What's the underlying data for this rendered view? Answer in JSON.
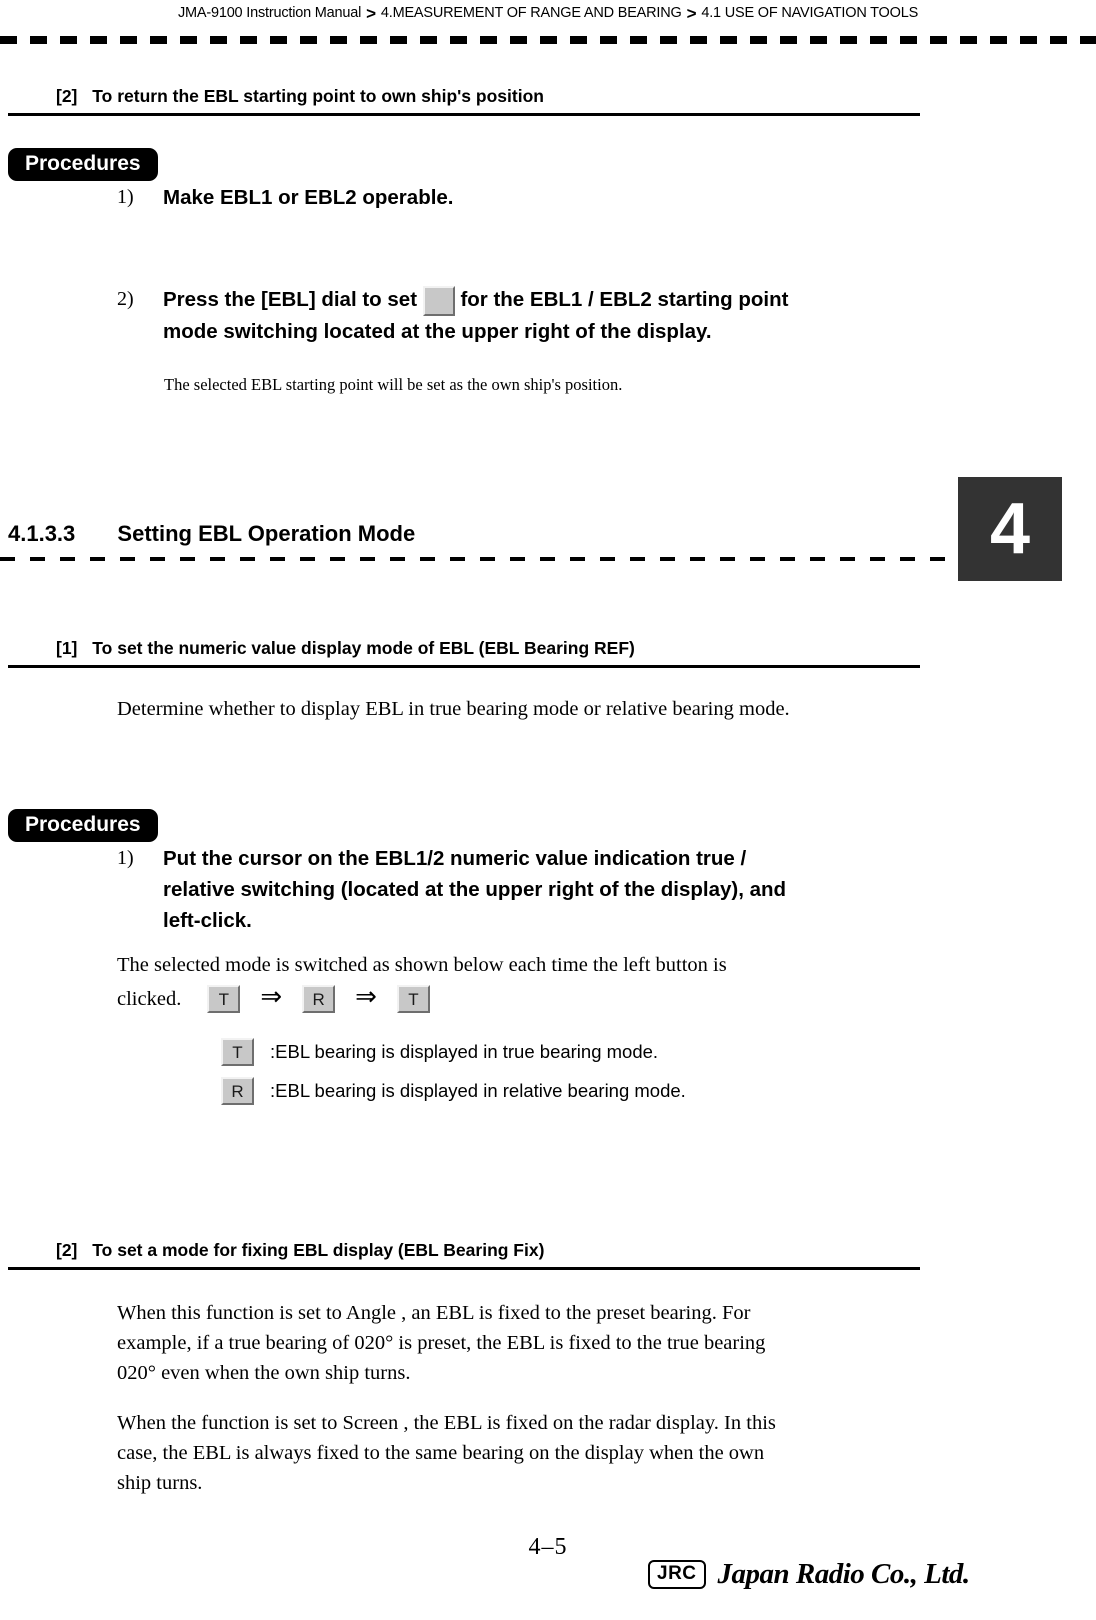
{
  "header": {
    "manual": "JMA-9100 Instruction Manual",
    "separator": ">",
    "chapter": "4.MEASUREMENT OF RANGE AND BEARING",
    "section": "4.1  USE OF NAVIGATION TOOLS"
  },
  "chapter_tab": {
    "number": "4"
  },
  "block1": {
    "heading_num": "[2]",
    "heading_text": "To return the EBL starting point to own ship's position",
    "procedures_label": "Procedures",
    "steps": [
      {
        "num": "1)",
        "text": "Make EBL1 or EBL2 operable."
      },
      {
        "num": "2)",
        "text_before": " Press the [EBL] dial to set",
        "button": "",
        "text_after": "for the EBL1 / EBL2 starting point",
        "line2": "mode switching located at the upper right of the display."
      }
    ],
    "note": "The selected EBL starting point will be set as the own ship's position."
  },
  "section_heading": {
    "number": "4.1.3.3",
    "title": "Setting EBL Operation Mode"
  },
  "block2": {
    "heading_num": "[1]",
    "heading_text": "To set the numeric value display mode of EBL (EBL Bearing REF)",
    "intro": "Determine whether to display EBL in true bearing mode or relative bearing mode.",
    "procedures_label": "Procedures",
    "step": {
      "num": "1)",
      "line1": "Put the cursor on the EBL1/2 numeric value indication true /",
      "line2": "relative switching (located at the upper right of the display), and",
      "line3": "left-click."
    },
    "explanation_line1": "The selected mode is switched as shown below each time the left button is",
    "explanation_line2": "clicked.",
    "switch_sequence": {
      "btn1": "T",
      "arrow1": "⇒",
      "btn2": "R",
      "arrow2": "⇒",
      "btn3": "T"
    },
    "legend": [
      {
        "button": "T",
        "text": ":EBL bearing is displayed in true bearing mode."
      },
      {
        "button": "R",
        "text": ":EBL bearing is displayed in relative bearing mode."
      }
    ]
  },
  "block3": {
    "heading_num": "[2]",
    "heading_text": "To set a mode for fixing EBL display (EBL Bearing Fix)",
    "para1_line1": "When this function is set to  Angle , an EBL is fixed to the preset bearing. For",
    "para1_line2": "example, if a true bearing of 020° is preset, the EBL is fixed to the true bearing",
    "para1_line3": "020° even when the own ship turns.",
    "para2_line1": "When the function is set to  Screen , the EBL is fixed on the radar display. In this",
    "para2_line2": "case, the EBL is always fixed to the same bearing on the display when the own",
    "para2_line3": "ship turns."
  },
  "footer": {
    "page_number": "4–5",
    "logo_mark": "JRC",
    "logo_name": "Japan Radio Co., Ltd."
  }
}
